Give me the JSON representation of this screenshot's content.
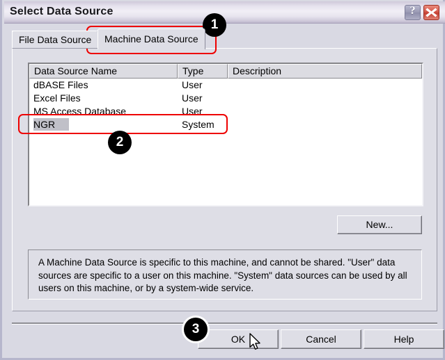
{
  "window": {
    "title": "Select Data Source",
    "help_button_glyph": "?",
    "help_button_name": "help-titlebar-button",
    "close_button_name": "close-button"
  },
  "tabs": [
    {
      "label": "File Data Source",
      "active": false
    },
    {
      "label": "Machine Data Source",
      "active": true
    }
  ],
  "list": {
    "columns": [
      "Data Source Name",
      "Type",
      "Description"
    ],
    "rows": [
      {
        "name": "dBASE Files",
        "type": "User",
        "description": "",
        "selected": false
      },
      {
        "name": "Excel Files",
        "type": "User",
        "description": "",
        "selected": false
      },
      {
        "name": "MS Access Database",
        "type": "User",
        "description": "",
        "selected": false
      },
      {
        "name": "NGR",
        "type": "System",
        "description": "",
        "selected": true
      }
    ]
  },
  "buttons": {
    "new": "New...",
    "ok": "OK",
    "cancel": "Cancel",
    "help": "Help"
  },
  "description": "A Machine Data Source is specific to this machine, and cannot be shared.  \"User\" data sources are specific to a user on this machine.  \"System\" data sources can be used by all users on this machine, or by a system-wide service.",
  "annotations": {
    "badges": [
      {
        "number": "1",
        "target": "machine-data-source-tab"
      },
      {
        "number": "2",
        "target": "ngr-data-source-row"
      },
      {
        "number": "3",
        "target": "ok-button"
      }
    ],
    "highlight_color": "#ee0000",
    "badge_color": "#000000"
  },
  "colors": {
    "dialog_face": "#dedee6",
    "list_background": "#ffffff",
    "selection": "#c0c0c8",
    "close_button": "#c33f32"
  }
}
